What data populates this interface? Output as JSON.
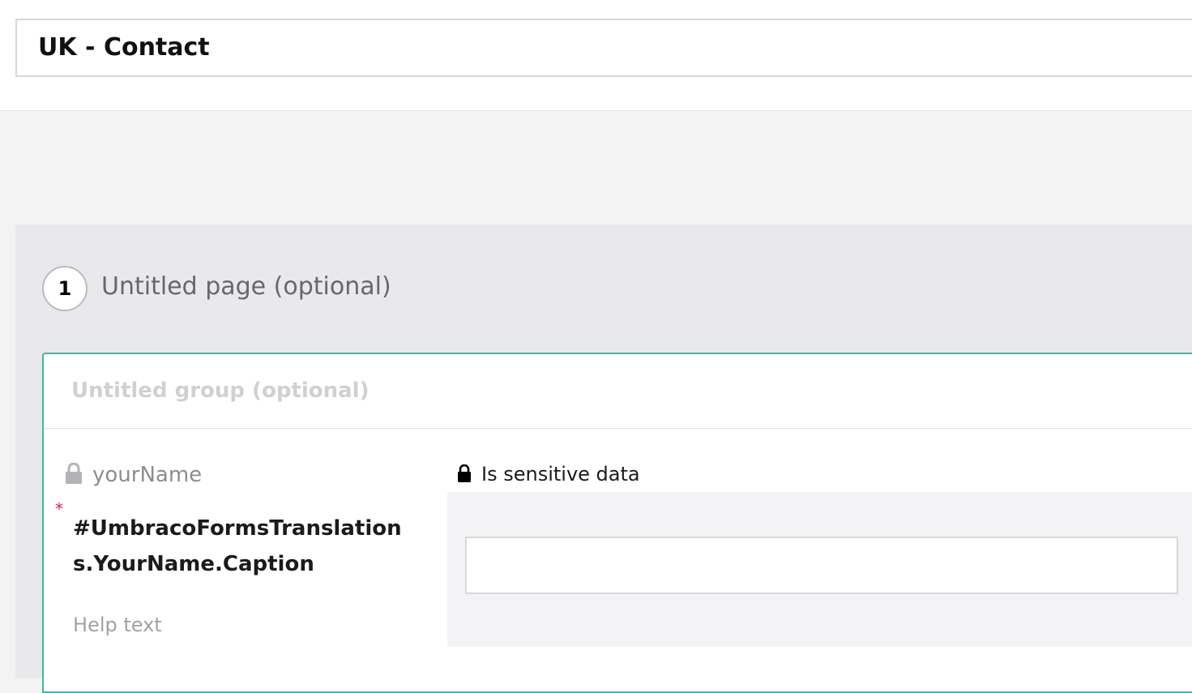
{
  "form": {
    "title": "UK - Contact"
  },
  "page": {
    "number": "1",
    "title": "Untitled page (optional)"
  },
  "group": {
    "title": "Untitled group (optional)"
  },
  "field": {
    "alias": "yourName",
    "required_marker": "*",
    "caption": "#UmbracoFormsTranslations.YourName.Caption",
    "help_text": "Help text",
    "sensitive_label": "Is sensitive data",
    "input_value": ""
  },
  "icons": {
    "alias_lock": "lock-icon",
    "sensitive_lock": "lock-icon"
  },
  "colors": {
    "group_border": "#3fb8a5",
    "required": "#d42054"
  }
}
